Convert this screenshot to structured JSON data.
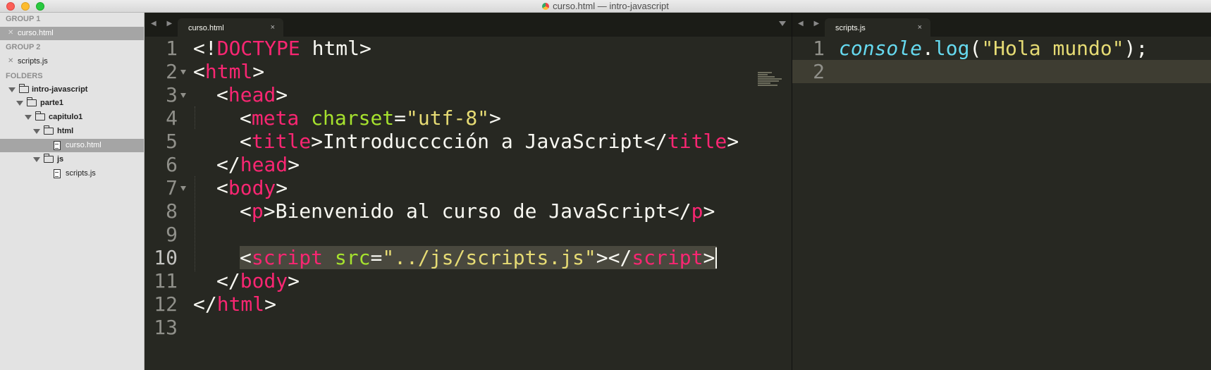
{
  "window": {
    "title": "curso.html — intro-javascript"
  },
  "sidebar": {
    "group1_label": "GROUP 1",
    "group1_file": "curso.html",
    "group2_label": "GROUP 2",
    "group2_file": "scripts.js",
    "folders_label": "FOLDERS",
    "tree": {
      "root": "intro-javascript",
      "parte1": "parte1",
      "capitulo1": "capitulo1",
      "html": "html",
      "curso": "curso.html",
      "js": "js",
      "scripts": "scripts.js"
    }
  },
  "left_pane": {
    "tab_label": "curso.html",
    "tab_close": "×",
    "nav_arrows": "◀ ▶",
    "lines": {
      "n1": "1",
      "n2": "2",
      "n3": "3",
      "n4": "4",
      "n5": "5",
      "n6": "6",
      "n7": "7",
      "n8": "8",
      "n9": "9",
      "n10": "10",
      "n11": "11",
      "n12": "12",
      "n13": "13"
    },
    "code": {
      "l1_doctype": "DOCTYPE",
      "l1_html": " html",
      "html": "html",
      "head": "head",
      "meta": "meta",
      "charset": "charset",
      "charset_val": "\"utf-8\"",
      "title": "title",
      "title_text": "Introducccción a JavaScript",
      "body": "body",
      "p": "p",
      "p_text": "Bienvenido al curso de JavaScript",
      "script": "script",
      "src": "src",
      "src_val": "\"../js/scripts.js\""
    }
  },
  "right_pane": {
    "tab_label": "scripts.js",
    "tab_close": "×",
    "nav_arrows": "◀ ▶",
    "lines": {
      "n1": "1",
      "n2": "2"
    },
    "code": {
      "console": "console",
      "log": "log",
      "arg": "\"Hola mundo\""
    }
  },
  "colors": {
    "background": "#272822",
    "tag": "#f92672",
    "attribute": "#a6e22e",
    "string": "#e6db74",
    "function": "#66d9ef",
    "text": "#f8f8f2"
  }
}
